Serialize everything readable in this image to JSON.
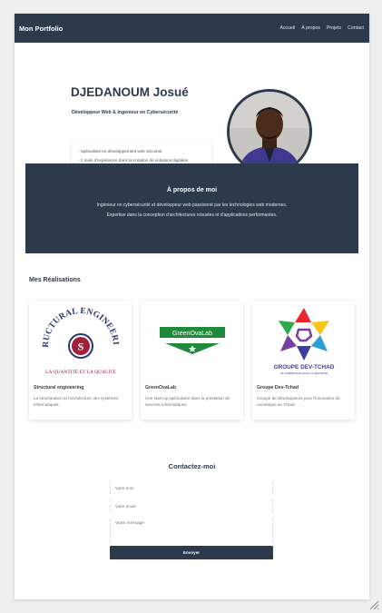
{
  "nav": {
    "brand": "Mon Portfolio",
    "links": [
      "Accueil",
      "À propos",
      "Projets",
      "Contact"
    ]
  },
  "hero": {
    "name": "DJEDANOUM Josué",
    "role": "Développeur Web & Ingenieur en Cybersécurité",
    "skills": [
      "- Spécialiste en développement web sécurisé",
      "- 1 mois d'expérience dans la création de solutions digitales"
    ]
  },
  "about": {
    "title": "À propos de moi",
    "text": "Ingénieur en cybersécurité et développeur web passionné par les technologies web modernes. Expertise dans la conception d'architectures robustes et d'applications performantes."
  },
  "projects": {
    "title": "Mes Réalisations",
    "items": [
      {
        "title": "Structural engineering",
        "desc": "La structuration et l'architecture des systèmes informatiques",
        "logo_arc_top": "STRUCTURAL ENGINEERING",
        "logo_letter": "S",
        "logo_bottom": "LA QUANTITÉ ET LA QUALITÉ"
      },
      {
        "title": "GreenOvaLab",
        "desc": "Une start-up spécialisée dans la prestation de services informatiques",
        "logo_text": "GreenOvaLab"
      },
      {
        "title": "Groupe Dev-Tchad",
        "desc": "Groupe de développeurs pour l'innovation du numerique au Tchad.",
        "logo_text": "GROUPE DEV-TCHAD",
        "logo_sub": "LE NUMÉRIQUE DANS LA SÉCURITÉ"
      }
    ]
  },
  "contact": {
    "title": "Contactez-moi",
    "name_placeholder": "Votre nom",
    "email_placeholder": "Votre email",
    "message_placeholder": "Votre message",
    "submit": "Envoyer"
  },
  "colors": {
    "primary": "#2d3a4b",
    "green": "#1e8a3a",
    "maroon": "#a0213a"
  }
}
